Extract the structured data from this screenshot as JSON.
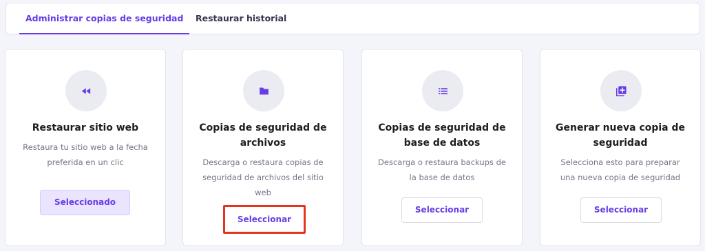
{
  "tabs": [
    {
      "label": "Administrar copias de seguridad",
      "active": true
    },
    {
      "label": "Restaurar historial",
      "active": false
    }
  ],
  "cards": [
    {
      "icon": "rewind-icon",
      "title": "Restaurar sitio web",
      "description": "Restaura tu sitio web a la fecha preferida en un clic",
      "button": "Seleccionado"
    },
    {
      "icon": "folder-icon",
      "title": "Copias de seguridad de archivos",
      "description": "Descarga o restaura copias de seguridad de archivos del sitio web",
      "button": "Seleccionar"
    },
    {
      "icon": "list-icon",
      "title": "Copias de seguridad de base de datos",
      "description": "Descarga o restaura backups de la base de datos",
      "button": "Seleccionar"
    },
    {
      "icon": "add-copy-icon",
      "title": "Generar nueva copia de seguridad",
      "description": "Selecciona esto para preparar una nueva copia de seguridad",
      "button": "Seleccionar"
    }
  ],
  "colors": {
    "accent": "#673de6",
    "highlight_border": "#e5341d",
    "selected_bg": "#ebe4ff"
  }
}
